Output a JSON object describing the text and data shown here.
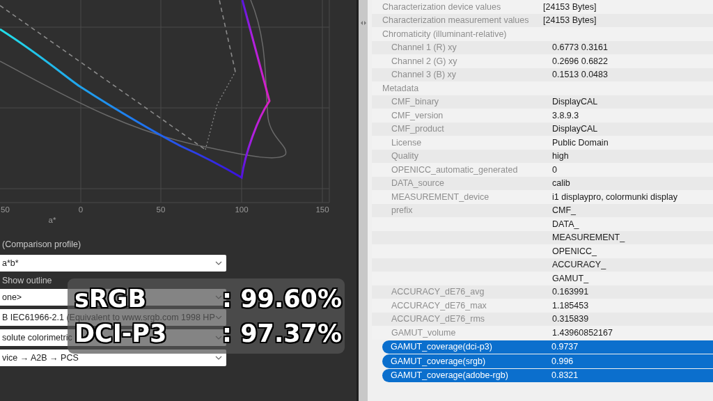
{
  "plot": {
    "x_axis_label": "a*",
    "x_ticks": [
      "50",
      "0",
      "50",
      "100",
      "150"
    ]
  },
  "comparison_label": "(Comparison profile)",
  "view_select": {
    "value": "a*b*"
  },
  "show_outline_label": "Show outline",
  "selects": [
    {
      "value": "one>"
    },
    {
      "value": "B IEC61966-2.1 (Equivalent to www.srgb.com 1998 HP"
    },
    {
      "value": "solute colorimetric"
    },
    {
      "value": "vice → A2B → PCS"
    }
  ],
  "coverage_overlay": [
    {
      "name": "sRGB",
      "value": ": 99.60%"
    },
    {
      "name": "DCI-P3",
      "value": ": 97.37%"
    }
  ],
  "tags": [
    {
      "label": "Characterization device values",
      "value": "[24153 Bytes]",
      "selected": false
    },
    {
      "label": "Characterization measurement values",
      "value": "[24153 Bytes]",
      "selected": false
    },
    {
      "label": "Chromaticity (illuminant-relative)",
      "selected": false,
      "children": [
        {
          "label": "Channel 1 (R) xy",
          "value": "0.6773 0.3161",
          "selected": false
        },
        {
          "label": "Channel 2 (G) xy",
          "value": "0.2696 0.6822",
          "selected": false
        },
        {
          "label": "Channel 3 (B) xy",
          "value": "0.1513 0.0483",
          "selected": false
        }
      ]
    },
    {
      "label": "Metadata",
      "selected": false,
      "children": [
        {
          "label": "CMF_binary",
          "value": "DisplayCAL",
          "selected": false
        },
        {
          "label": "CMF_version",
          "value": "3.8.9.3",
          "selected": false
        },
        {
          "label": "CMF_product",
          "value": "DisplayCAL",
          "selected": false
        },
        {
          "label": "License",
          "value": "Public Domain",
          "selected": false
        },
        {
          "label": "Quality",
          "value": "high",
          "selected": false
        },
        {
          "label": "OPENICC_automatic_generated",
          "value": "0",
          "selected": false
        },
        {
          "label": "DATA_source",
          "value": "calib",
          "selected": false
        },
        {
          "label": "MEASUREMENT_device",
          "value": "i1 displaypro, colormunki display",
          "selected": false
        },
        {
          "label": "prefix",
          "value": "CMF_",
          "selected": false
        },
        {
          "value": "DATA_",
          "selected": false
        },
        {
          "value": "MEASUREMENT_",
          "selected": false
        },
        {
          "value": "OPENICC_",
          "selected": false
        },
        {
          "value": "ACCURACY_",
          "selected": false
        },
        {
          "value": "GAMUT_",
          "selected": false
        },
        {
          "label": "ACCURACY_dE76_avg",
          "value": "0.163991",
          "selected": false
        },
        {
          "label": "ACCURACY_dE76_max",
          "value": "1.185453",
          "selected": false
        },
        {
          "label": "ACCURACY_dE76_rms",
          "value": "0.315839",
          "selected": false
        },
        {
          "label": "GAMUT_volume",
          "value": "1.43960852167",
          "selected": false
        },
        {
          "label": "GAMUT_coverage(dci-p3)",
          "value": "0.9737",
          "selected": true
        },
        {
          "label": "GAMUT_coverage(srgb)",
          "value": "0.996",
          "selected": true
        },
        {
          "label": "GAMUT_coverage(adobe-rgb)",
          "value": "0.8321",
          "selected": true
        }
      ]
    }
  ]
}
